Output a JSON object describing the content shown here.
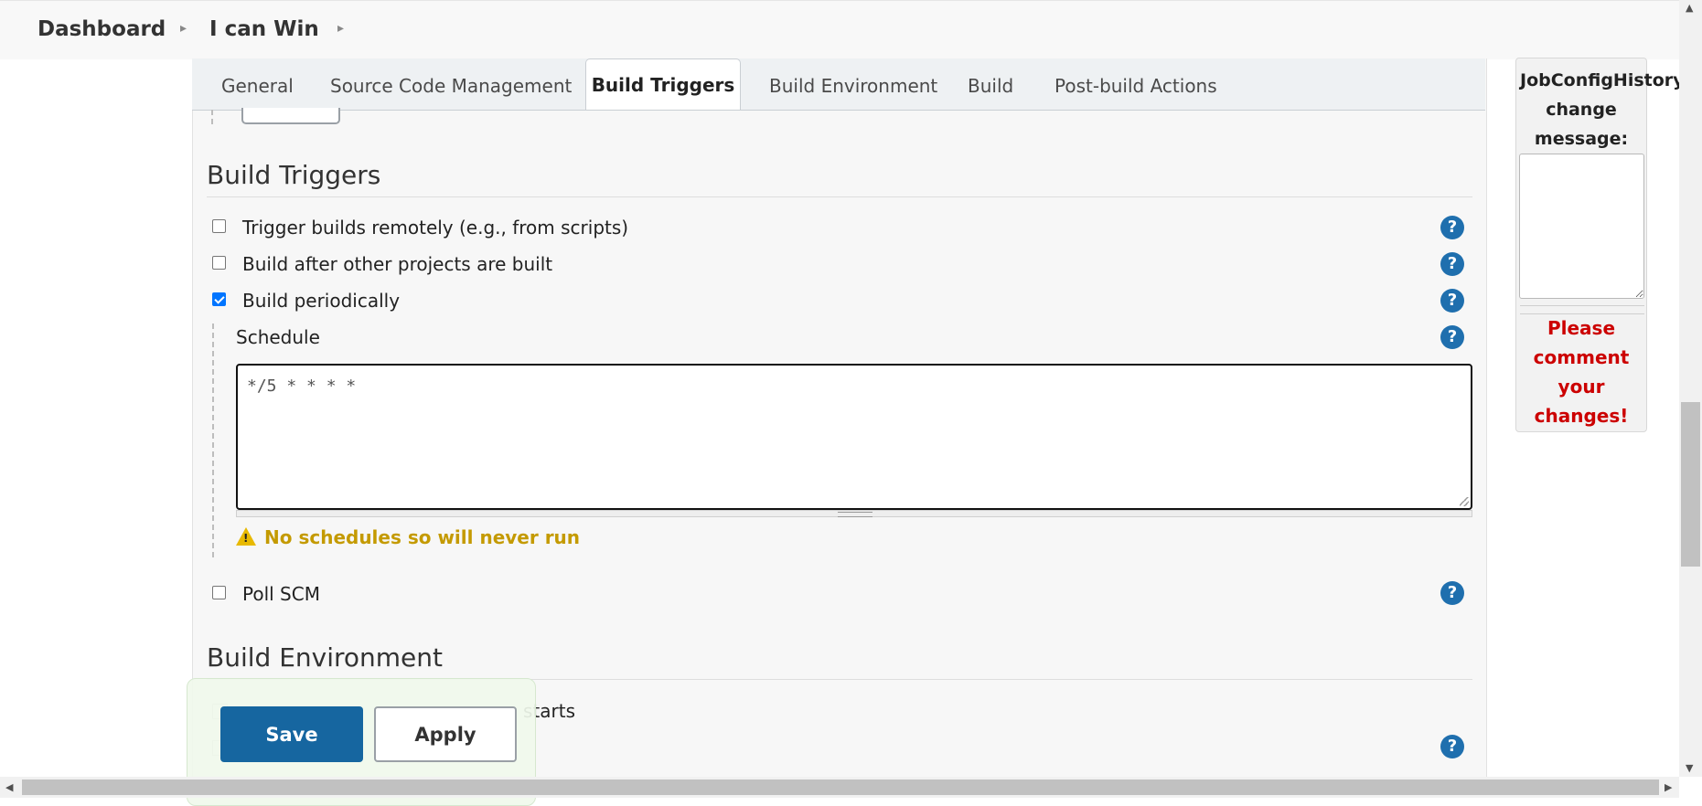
{
  "breadcrumb": {
    "items": [
      "Dashboard",
      "I can Win"
    ],
    "separator_icon": "chevron-right-icon"
  },
  "tabs": [
    {
      "label": "General",
      "active": false
    },
    {
      "label": "Source Code Management",
      "active": false
    },
    {
      "label": "Build Triggers",
      "active": true
    },
    {
      "label": "Build Environment",
      "active": false
    },
    {
      "label": "Build",
      "active": false
    },
    {
      "label": "Post-build Actions",
      "active": false
    }
  ],
  "build_triggers": {
    "title": "Build Triggers",
    "options": [
      {
        "label": "Trigger builds remotely (e.g., from scripts)",
        "checked": false
      },
      {
        "label": "Build after other projects are built",
        "checked": false
      },
      {
        "label": "Build periodically",
        "checked": true
      }
    ],
    "schedule": {
      "label": "Schedule",
      "value": "*/5 * * * *",
      "warning": "No schedules so will never run"
    },
    "poll_scm": {
      "label": "Poll SCM",
      "checked": false
    }
  },
  "build_environment": {
    "title": "Build Environment",
    "obscured_row_visible_text": "starts",
    "obscured_row_prefix": "s"
  },
  "actions": {
    "save_label": "Save",
    "apply_label": "Apply"
  },
  "side_panel": {
    "title": "JobConfigHistory change message:",
    "textarea_value": "",
    "warning": "Please comment your changes!"
  },
  "colors": {
    "primary": "#1666a0",
    "help_icon": "#1f6fae",
    "warning_text": "#c49a00",
    "error_text": "#cc0000",
    "checkbox_checked": "#0075ff"
  },
  "help_icon_glyph": "?",
  "warning_icon_glyph": "!"
}
